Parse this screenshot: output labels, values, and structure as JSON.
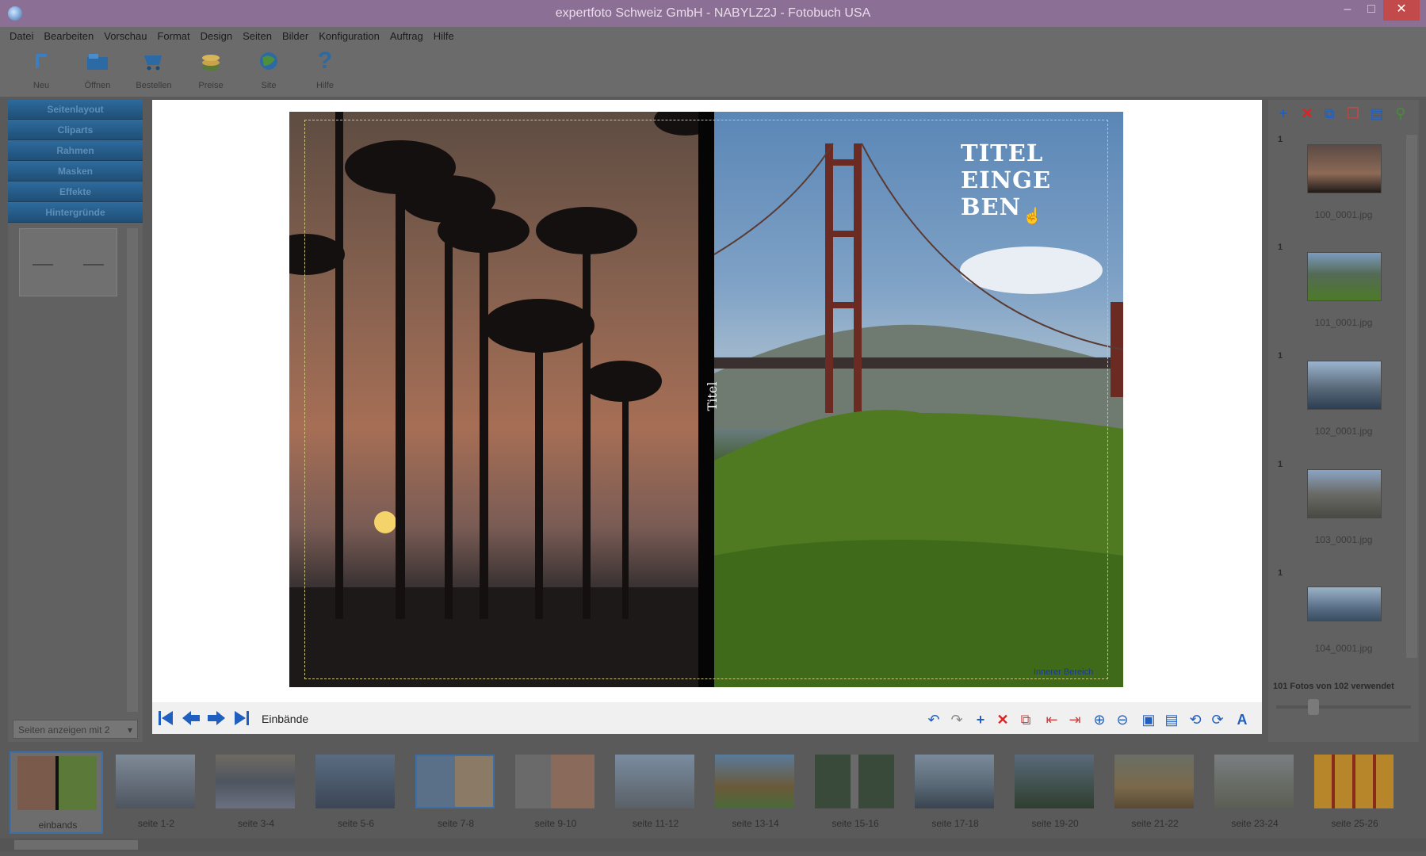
{
  "window": {
    "title": "expertfoto Schweiz GmbH - NABYLZ2J - Fotobuch USA"
  },
  "menu": [
    "Datei",
    "Bearbeiten",
    "Vorschau",
    "Format",
    "Design",
    "Seiten",
    "Bilder",
    "Konfiguration",
    "Auftrag",
    "Hilfe"
  ],
  "toolbar": [
    {
      "label": "Neu",
      "icon": "new-icon"
    },
    {
      "label": "Öffnen",
      "icon": "open-icon"
    },
    {
      "label": "Bestellen",
      "icon": "cart-icon"
    },
    {
      "label": "Preise",
      "icon": "coins-icon"
    },
    {
      "label": "Site",
      "icon": "globe-icon"
    },
    {
      "label": "Hilfe",
      "icon": "help-icon"
    }
  ],
  "left_panel": {
    "tabs": [
      "Seitenlayout",
      "Cliparts",
      "Rahmen",
      "Masken",
      "Effekte",
      "Hintergründe"
    ],
    "pages_select": "Seiten anzeigen mit 2"
  },
  "canvas": {
    "spine_title": "Titel",
    "cover_title_lines": [
      "Titel",
      "einge",
      "ben"
    ],
    "inner_area_label": "Innerer Bereich",
    "nav_label": "Einbände"
  },
  "right_panel": {
    "photos": [
      {
        "num": "1",
        "name": "100_0001.jpg"
      },
      {
        "num": "1",
        "name": "101_0001.jpg"
      },
      {
        "num": "1",
        "name": "102_0001.jpg"
      },
      {
        "num": "1",
        "name": "103_0001.jpg"
      },
      {
        "num": "1",
        "name": "104_0001.jpg"
      }
    ],
    "photo_count": "101 Fotos von 102 verwendet"
  },
  "filmstrip": [
    {
      "label": "einbands",
      "selected": true
    },
    {
      "label": "seite 1-2"
    },
    {
      "label": "seite 3-4"
    },
    {
      "label": "seite 5-6"
    },
    {
      "label": "seite 7-8"
    },
    {
      "label": "seite 9-10"
    },
    {
      "label": "seite 11-12"
    },
    {
      "label": "seite 13-14"
    },
    {
      "label": "seite 15-16"
    },
    {
      "label": "seite 17-18"
    },
    {
      "label": "seite 19-20"
    },
    {
      "label": "seite 21-22"
    },
    {
      "label": "seite 23-24"
    },
    {
      "label": "seite 25-26"
    }
  ],
  "colors": {
    "titlebar": "#8c6f95",
    "tab": "#2d6a9c",
    "accent": "#1f5fbf"
  }
}
